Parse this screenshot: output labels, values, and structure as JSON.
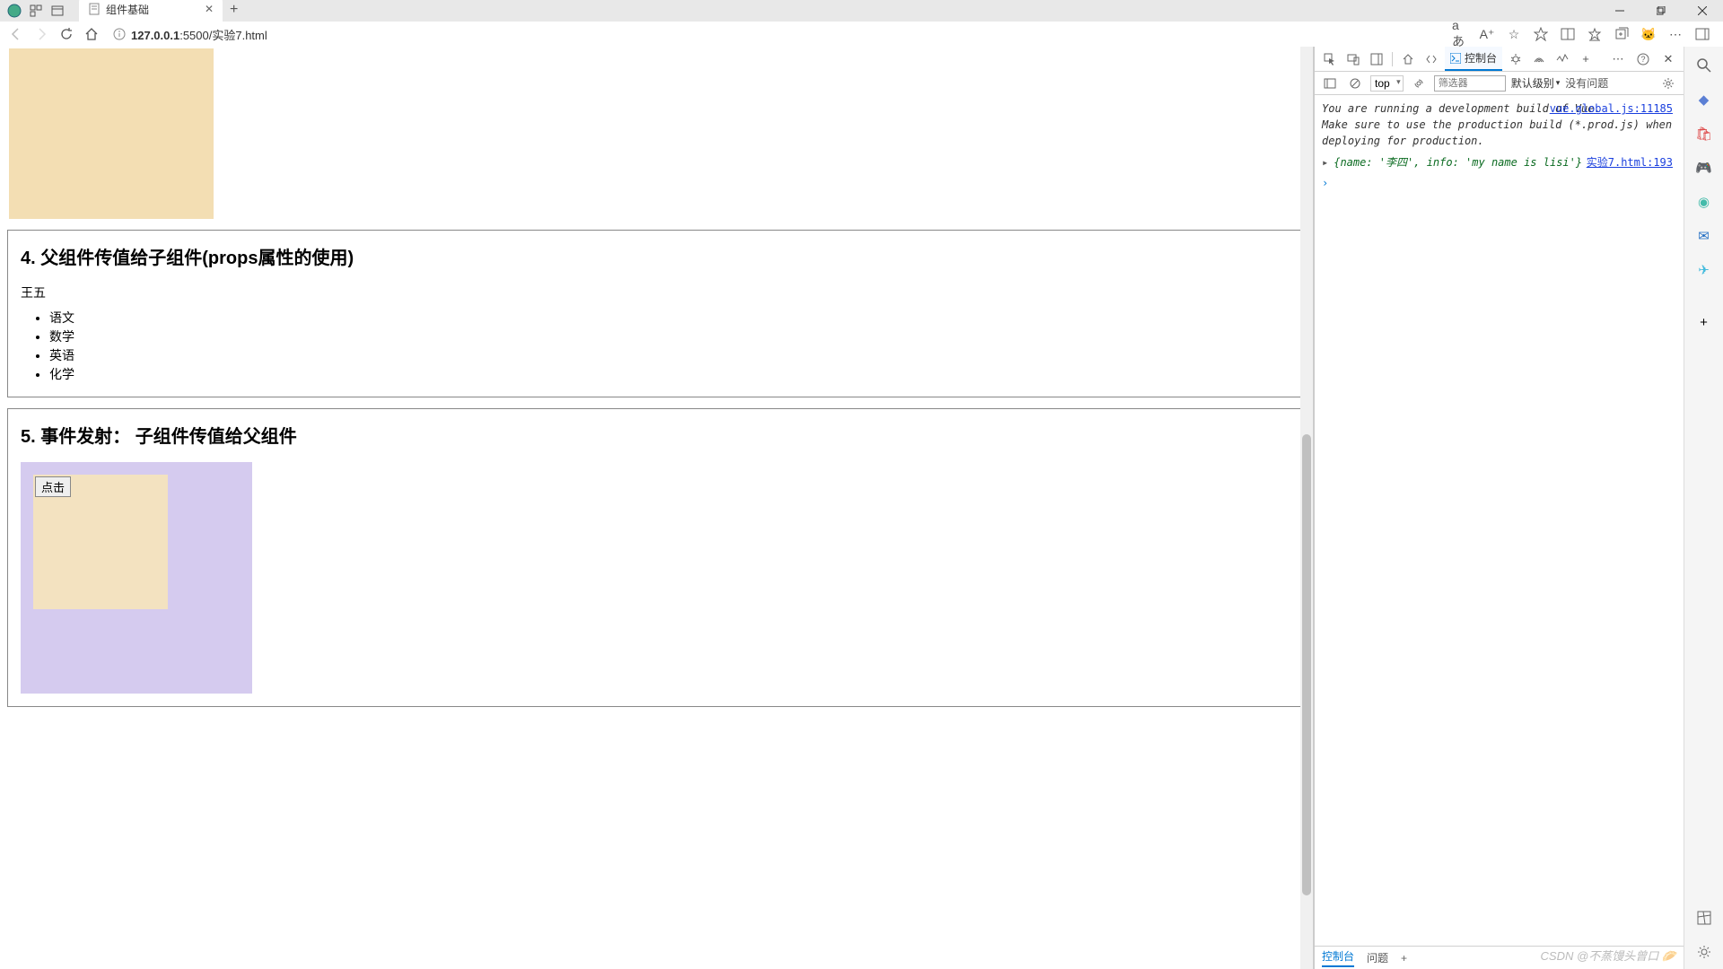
{
  "browser": {
    "tab_title": "组件基础",
    "url_host": "127.0.0.1",
    "url_path": ":5500/实验7.html",
    "reading_icon": "aあ",
    "font_icon": "A⁺"
  },
  "page": {
    "section4_title": "4. 父组件传值给子组件(props属性的使用)",
    "student_name": "王五",
    "subjects": [
      "语文",
      "数学",
      "英语",
      "化学"
    ],
    "section5_title": "5. 事件发射：  子组件传值给父组件",
    "click_button": "点击"
  },
  "devtools": {
    "tab_console": "控制台",
    "context": "top",
    "filter_placeholder": "筛选器",
    "level_label": "默认级别",
    "no_issues": "没有问题",
    "warn_line1": "You are running a development build of Vue.",
    "warn_line2": "Make sure to use the production build (*.prod.js) when",
    "warn_line3": "deploying for production.",
    "warn_link": "vue.global.js:11185",
    "log_object": "{name: '李四', info: 'my name is lisi'}",
    "log_link": "实验7.html:193",
    "bottom_console": "控制台",
    "bottom_issues": "问题"
  },
  "watermark": "CSDN @不蒸馒头曾口 🥟"
}
